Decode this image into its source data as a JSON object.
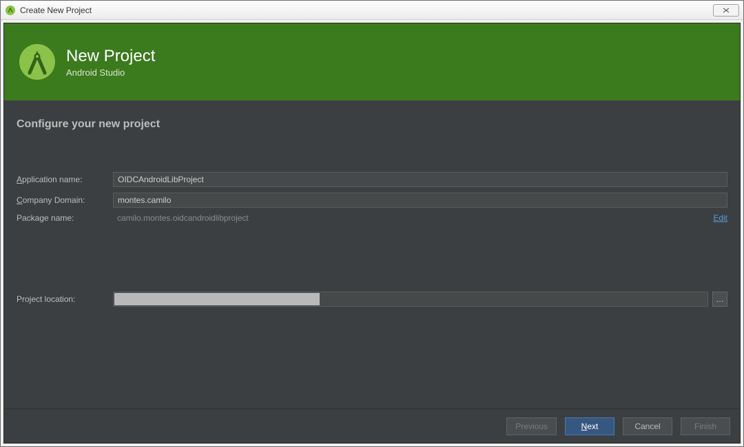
{
  "window": {
    "title": "Create New Project",
    "close_glyph": "✕"
  },
  "banner": {
    "title": "New Project",
    "subtitle": "Android Studio"
  },
  "section": {
    "title": "Configure your new project"
  },
  "fields": {
    "app_name": {
      "prefix": "A",
      "label_rest": "pplication name:",
      "value": "OIDCAndroidLibProject"
    },
    "company_domain": {
      "prefix": "C",
      "label_rest": "ompany Domain:",
      "value": "montes.camilo"
    },
    "package_name": {
      "label": "Package name:",
      "value": "camilo.montes.oidcandroidlibproject",
      "edit": "Edit"
    },
    "project_location": {
      "label": "Project location:",
      "value": "",
      "browse": "…"
    }
  },
  "footer": {
    "previous": "Previous",
    "next_prefix": "N",
    "next_rest": "ext",
    "cancel": "Cancel",
    "finish": "Finish"
  },
  "colors": {
    "banner_bg": "#3c7a1e",
    "client_bg": "#3c3f41",
    "primary_btn_bg": "#365880",
    "link": "#5a9bd4"
  }
}
